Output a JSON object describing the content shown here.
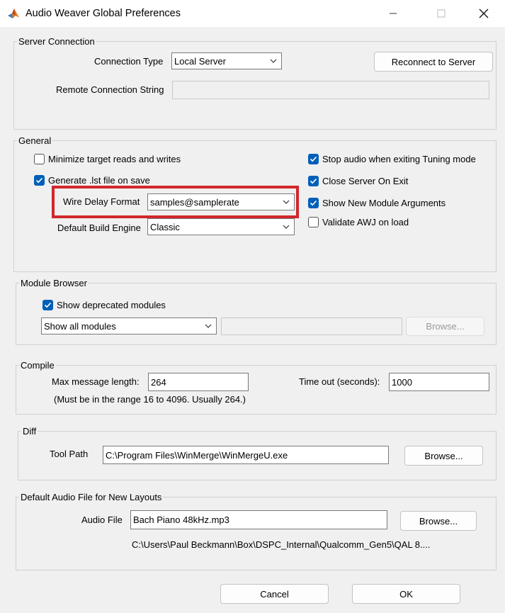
{
  "window": {
    "title": "Audio Weaver Global Preferences"
  },
  "server": {
    "group_title": "Server Connection",
    "connection_type_label": "Connection Type",
    "connection_type_value": "Local Server",
    "reconnect_label": "Reconnect to Server",
    "remote_label": "Remote Connection String",
    "remote_value": ""
  },
  "general": {
    "group_title": "General",
    "minimize_label": "Minimize target reads and writes",
    "minimize_checked": false,
    "lst_label": "Generate .lst file on save",
    "lst_checked": true,
    "wire_delay_label": "Wire Delay Format",
    "wire_delay_value": "samples@samplerate",
    "build_engine_label": "Default Build Engine",
    "build_engine_value": "Classic",
    "stop_audio_label": "Stop audio when exiting Tuning mode",
    "stop_audio_checked": true,
    "close_server_label": "Close Server On Exit",
    "close_server_checked": true,
    "show_args_label": "Show New Module Arguments",
    "show_args_checked": true,
    "validate_label": "Validate AWJ on load",
    "validate_checked": false
  },
  "module_browser": {
    "group_title": "Module Browser",
    "deprecated_label": "Show deprecated modules",
    "deprecated_checked": true,
    "filter_value": "Show all modules",
    "path_value": "",
    "browse_label": "Browse..."
  },
  "compile": {
    "group_title": "Compile",
    "max_msg_label": "Max message length:",
    "max_msg_value": "264",
    "range_note": "(Must be in the range 16 to 4096.  Usually 264.)",
    "timeout_label": "Time out (seconds):",
    "timeout_value": "1000"
  },
  "diff": {
    "group_title": "Diff",
    "tool_path_label": "Tool Path",
    "tool_path_value": "C:\\Program Files\\WinMerge\\WinMergeU.exe",
    "browse_label": "Browse..."
  },
  "audio": {
    "group_title": "Default Audio File for New Layouts",
    "file_label": "Audio File",
    "file_value": "Bach Piano 48kHz.mp3",
    "browse_label": "Browse...",
    "full_path": "C:\\Users\\Paul Beckmann\\Box\\DSPC_Internal\\Qualcomm_Gen5\\QAL 8...."
  },
  "footer": {
    "cancel_label": "Cancel",
    "ok_label": "OK"
  },
  "colors": {
    "accent": "#005fb8",
    "highlight": "#d1272b"
  }
}
